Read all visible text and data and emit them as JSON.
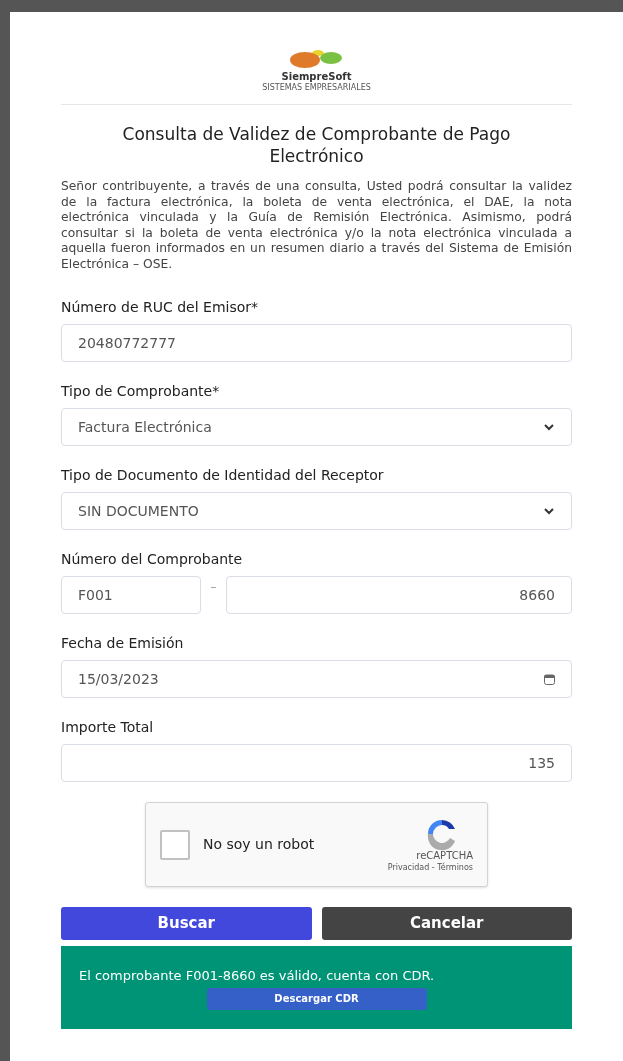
{
  "logo": {
    "name": "SiempreSoft",
    "tagline": "SISTEMAS EMPRESARIALES"
  },
  "title": "Consulta de Validez de Comprobante de Pago Electrónico",
  "intro": "Señor contribuyente, a través de una consulta, Usted podrá consultar la validez de la factura electrónica, la boleta de venta electrónica, el DAE, la nota electrónica vinculada y la Guía de Remisión Electrónica. Asimismo, podrá consultar si la boleta de venta electrónica y/o la nota electrónica vinculada a aquella fueron informados en un resumen diario a través del Sistema de Emisión Electrónica – OSE.",
  "fields": [
    {
      "kind": "text",
      "label": "Número de RUC del Emisor*",
      "value": "20480772777"
    },
    {
      "kind": "select",
      "label": "Tipo de Comprobante*",
      "value": "Factura Electrónica"
    },
    {
      "kind": "select",
      "label": "Tipo de Documento de Identidad del Receptor",
      "value": "SIN DOCUMENTO"
    },
    {
      "kind": "split",
      "label": "Número del Comprobante",
      "series": "F001",
      "separator": "–",
      "number": "8660"
    },
    {
      "kind": "date",
      "label": "Fecha de Emisión",
      "value": "15/03/2023"
    },
    {
      "kind": "amount",
      "label": "Importe Total",
      "value": "135"
    }
  ],
  "captcha": {
    "label": "No soy un robot",
    "checked": false,
    "brand": "reCAPTCHA",
    "links": "Privacidad - Términos"
  },
  "buttons": [
    {
      "kind": "primary",
      "label": "Buscar"
    },
    {
      "kind": "secondary",
      "label": "Cancelar"
    }
  ],
  "result": {
    "message": "El comprobante F001-8660 es válido, cuenta con CDR.",
    "button": "Descargar CDR"
  }
}
